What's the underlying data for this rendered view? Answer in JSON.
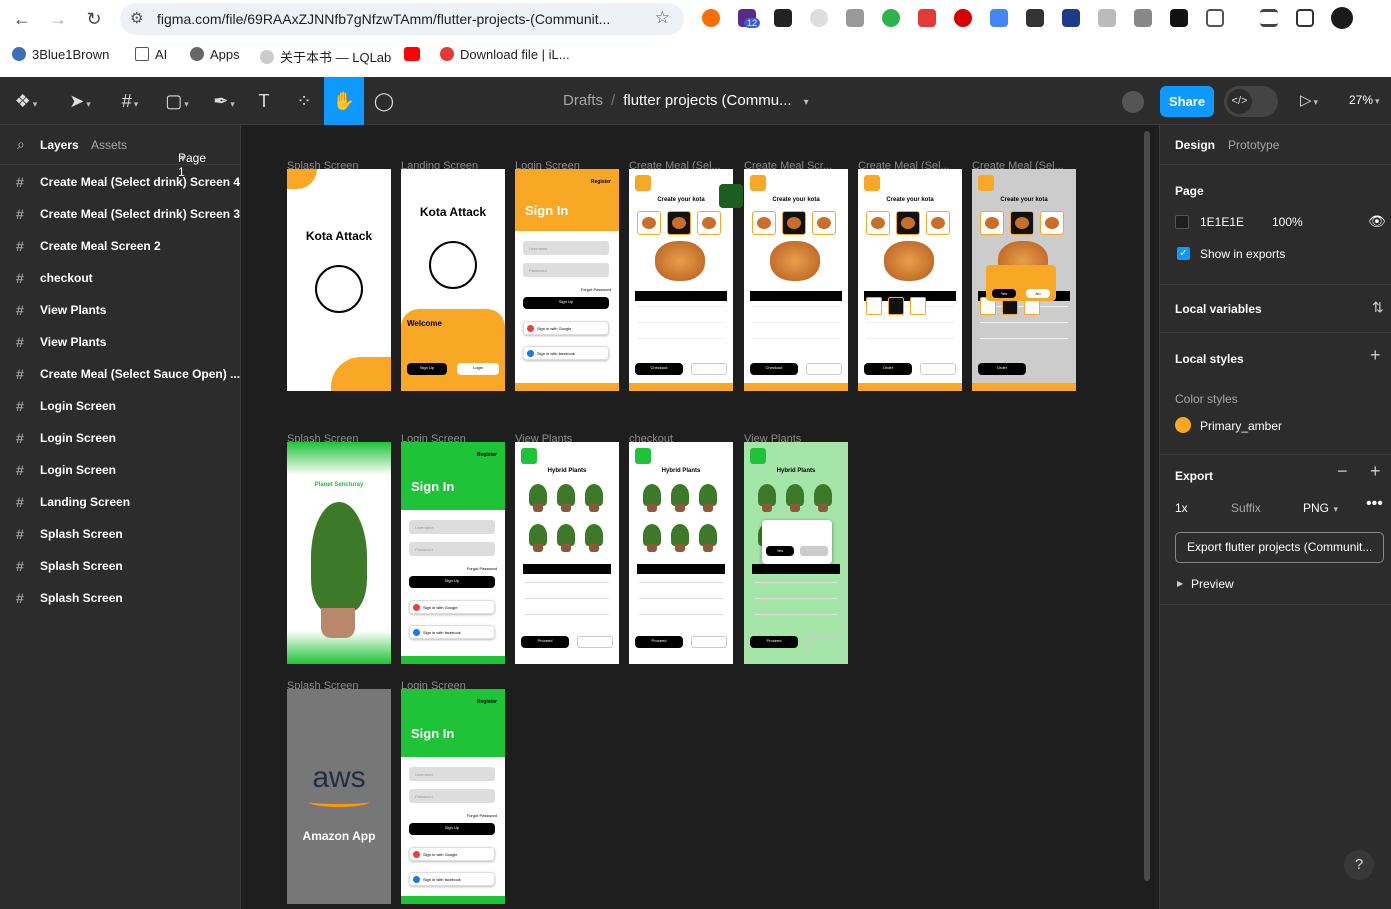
{
  "browser": {
    "url": "figma.com/file/69RAAxZJNNfb7gNfzwTAmm/flutter-projects-(Communit...",
    "ext_badge": "12",
    "bookmarks": [
      "3Blue1Brown",
      "AI",
      "Apps",
      "关于本书 — LQLab",
      "Download file | iL..."
    ]
  },
  "toolbar": {
    "breadcrumb_root": "Drafts",
    "breadcrumb_sep": "/",
    "file_name": "flutter projects (Commu...",
    "share_label": "Share",
    "zoom": "27%"
  },
  "left_panel": {
    "tab_layers": "Layers",
    "tab_assets": "Assets",
    "page_label": "Page 1",
    "layers": [
      "Create Meal (Select drink) Screen 4",
      "Create Meal (Select drink) Screen 3",
      "Create Meal Screen 2",
      "checkout",
      "View Plants",
      "View Plants",
      "Create Meal (Select Sauce Open) ...",
      "Login Screen",
      "Login Screen",
      "Login Screen",
      "Landing Screen",
      "Splash Screen",
      "Splash Screen",
      "Splash Screen"
    ]
  },
  "right_panel": {
    "tab_design": "Design",
    "tab_prototype": "Prototype",
    "page_title": "Page",
    "page_color": "1E1E1E",
    "page_opacity": "100%",
    "show_exports": "Show in exports",
    "local_variables": "Local variables",
    "local_styles": "Local styles",
    "color_styles": "Color styles",
    "style_name": "Primary_amber",
    "style_color": "#f9a825",
    "export_title": "Export",
    "export_scale": "1x",
    "export_suffix": "Suffix",
    "export_format": "PNG",
    "export_button": "Export flutter projects (Communit...",
    "preview": "Preview"
  },
  "canvas": {
    "row1": [
      {
        "label": "Splash Screen"
      },
      {
        "label": "Landing Screen"
      },
      {
        "label": "Login Screen"
      },
      {
        "label": "Create Meal (Sel..."
      },
      {
        "label": "Create Meal Scr..."
      },
      {
        "label": "Create Meal (Sel..."
      },
      {
        "label": "Create Meal (Sel..."
      }
    ],
    "row2": [
      {
        "label": "Splash Screen"
      },
      {
        "label": "Login Screen"
      },
      {
        "label": "View Plants"
      },
      {
        "label": "checkout"
      },
      {
        "label": "View Plants"
      }
    ],
    "row3": [
      {
        "label": "Splash Screen"
      },
      {
        "label": "Login Screen"
      }
    ],
    "texts": {
      "kota": "Kota Attack",
      "welcome": "Welcome",
      "register": "Register",
      "sign_in": "Sign In",
      "create_kota": "Create your kota",
      "planet": "Planet Sencturay",
      "hybrid": "Hybrid Plants",
      "aws": "aws",
      "amazon": "Amazon App",
      "checkout": "Checkout",
      "order": "Order",
      "proceed": "Proceed",
      "login": "Login",
      "sign_up": "Sign Up",
      "username": "Username",
      "password": "Password",
      "forgot": "Forgot Password",
      "google": "Sign in with Google",
      "facebook": "Sign in with facebook",
      "yes": "Yes",
      "no": "No"
    }
  }
}
